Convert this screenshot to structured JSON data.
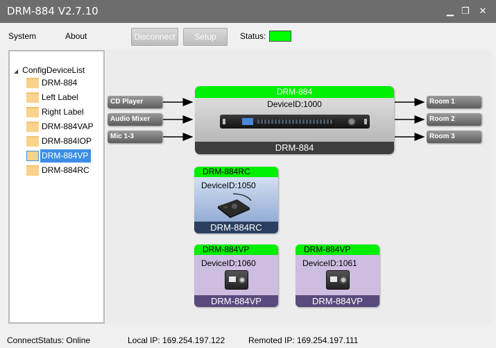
{
  "window": {
    "title": "DRM-884  V2.7.10",
    "minimize_glyph": "▁",
    "restore_glyph": "❐",
    "close_glyph": "✕"
  },
  "menu": {
    "system": "System",
    "about": "About"
  },
  "toolbar": {
    "disconnect": "Disconnect",
    "setup": "Setup",
    "status_label": "Status:",
    "status_color": "#00ff00"
  },
  "tree": {
    "root": "ConfigDeviceList",
    "items": [
      "DRM-884",
      "Left Label",
      "Right Label",
      "DRM-884VAP",
      "DRM-884IOP",
      "DRM-884VP",
      "DRM-884RC"
    ],
    "selected": "DRM-884VP"
  },
  "inputs": [
    "CD Player",
    "Audio Mixer",
    "Mic 1-3"
  ],
  "outputs": [
    "Room 1",
    "Room 2",
    "Room 3"
  ],
  "main_device": {
    "name": "DRM-884",
    "device_id": "DeviceID:1000",
    "footer": "DRM-884"
  },
  "rc_device": {
    "name": "DRM-884RC",
    "device_id": "DeviceID:1050",
    "footer": "DRM-884RC"
  },
  "vp_devices": [
    {
      "name": "DRM-884VP",
      "device_id": "DeviceID:1060",
      "footer": "DRM-884VP"
    },
    {
      "name": "DRM-884VP",
      "device_id": "DeviceID:1061",
      "footer": "DRM-884VP"
    }
  ],
  "statusbar": {
    "connect_status": "ConnectStatus:  Online",
    "local_ip": "Local IP:  169.254.197.122",
    "remote_ip": "Remoted IP:  169.254.197.111"
  }
}
